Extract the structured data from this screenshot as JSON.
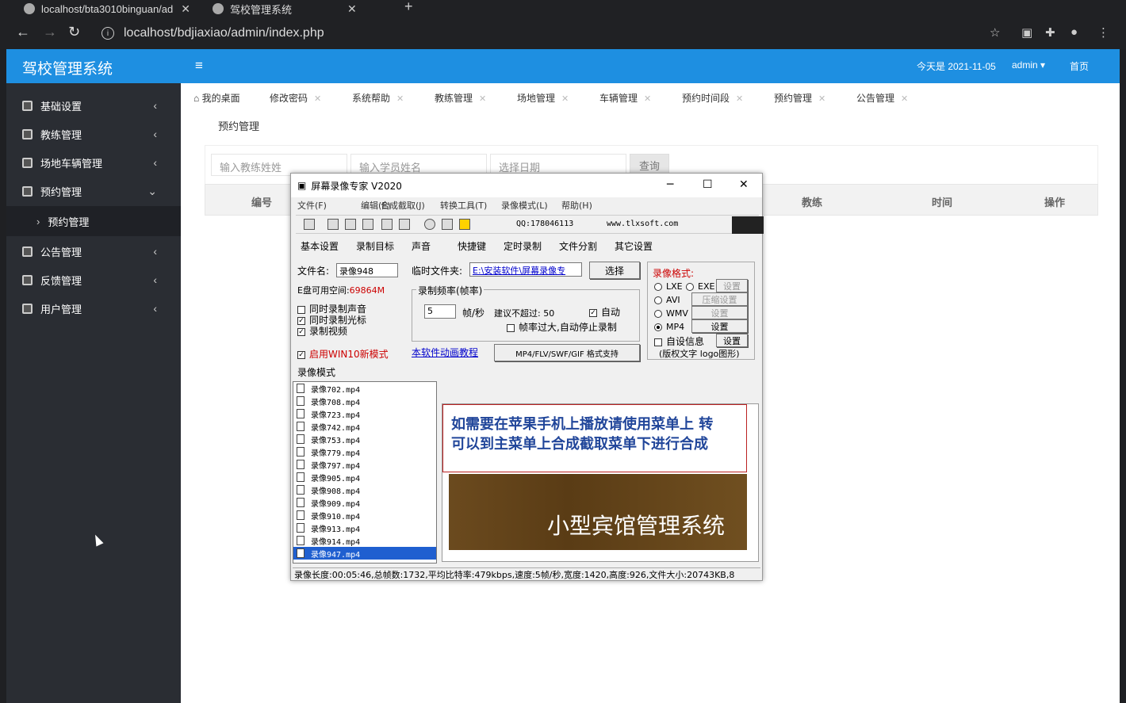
{
  "browser": {
    "tabs": [
      {
        "title": "localhost/bta3010binguan/ad"
      },
      {
        "title": "驾校管理系统"
      }
    ],
    "url": "localhost/bdjiaxiao/admin/index.php"
  },
  "app": {
    "brand": "驾校管理系统",
    "date_label": "今天是 2021-11-05",
    "user": "admin",
    "home": "首页",
    "accent": "#1e8fe1"
  },
  "sidebar": {
    "items": [
      {
        "label": "基础设置"
      },
      {
        "label": "教练管理"
      },
      {
        "label": "场地车辆管理"
      },
      {
        "label": "预约管理"
      },
      {
        "label": "预约管理"
      },
      {
        "label": "公告管理"
      },
      {
        "label": "反馈管理"
      },
      {
        "label": "用户管理"
      }
    ]
  },
  "page_tabs": [
    {
      "label": "我的桌面"
    },
    {
      "label": "修改密码"
    },
    {
      "label": "系统帮助"
    },
    {
      "label": "教练管理"
    },
    {
      "label": "场地管理"
    },
    {
      "label": "车辆管理"
    },
    {
      "label": "预约时间段"
    },
    {
      "label": "预约管理"
    },
    {
      "label": "公告管理"
    }
  ],
  "page": {
    "title": "预约管理",
    "coach_placeholder": "输入教练姓姓",
    "student_placeholder": "输入学员姓名",
    "date_placeholder": "选择日期",
    "query": "查询",
    "columns": [
      "编号",
      "教练",
      "时间",
      "操作"
    ]
  },
  "recorder": {
    "title": "屏幕录像专家 V2020",
    "menu": [
      "文件(F)",
      "编辑(E)",
      "合成截取(J)",
      "转换工具(T)",
      "录像模式(L)",
      "帮助(H)"
    ],
    "qq": "QQ:178046113",
    "site": "www.tlxsoft.com",
    "tabs": [
      "基本设置",
      "录制目标",
      "声音",
      "快捷键",
      "定时录制",
      "文件分割",
      "其它设置"
    ],
    "filename_label": "文件名:",
    "filename": "录像948",
    "disk_label": "E盘可用空间:",
    "disk_value": "69864M",
    "temp_label": "临时文件夹:",
    "temp_path": "E:\\安装软件\\屏幕录像专",
    "choose": "选择",
    "rate_group": "录制频率(帧率)",
    "fps": "5",
    "fps_unit": "帧/秒",
    "suggest": "建议不超过: 50",
    "auto": "自动",
    "too_high": "帧率过大,自动停止录制",
    "checks": [
      "同时录制声音",
      "同时录制光标",
      "录制视频"
    ],
    "win10": "启用WIN10新模式",
    "mode": "录像模式",
    "tutorial": "本软件动画教程",
    "formats_btn": "MP4/FLV/SWF/GIF  格式支持",
    "format_group": "录像格式:",
    "formats": [
      "LXE",
      "EXE",
      "AVI",
      "WMV",
      "MP4"
    ],
    "setting": "设置",
    "compress": "压缩设置",
    "custom_info": "自设信息",
    "watermark": "(版权文字 logo图形)",
    "files": [
      "录像702.mp4",
      "录像708.mp4",
      "录像723.mp4",
      "录像742.mp4",
      "录像753.mp4",
      "录像779.mp4",
      "录像797.mp4",
      "录像905.mp4",
      "录像908.mp4",
      "录像909.mp4",
      "录像910.mp4",
      "录像913.mp4",
      "录像914.mp4",
      "录像947.mp4"
    ],
    "notice_line1": "如需要在苹果手机上播放请使用菜单上 转",
    "notice_line2": "可以到主菜单上合成截取菜单下进行合成",
    "banner": "小型宾馆管理系统",
    "status": "录像长度:00:05:46,总帧数:1732,平均比特率:479kbps,速度:5帧/秒,宽度:1420,高度:926,文件大小:20743KB,8"
  }
}
